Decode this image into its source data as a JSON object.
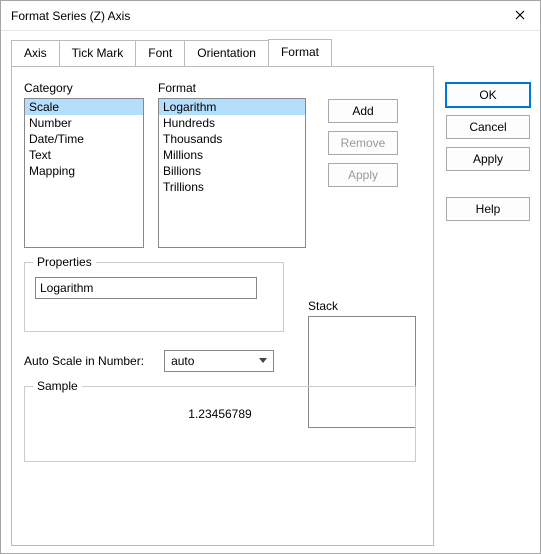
{
  "window": {
    "title": "Format Series (Z) Axis"
  },
  "tabs": [
    "Axis",
    "Tick Mark",
    "Font",
    "Orientation",
    "Format"
  ],
  "active_tab": "Format",
  "labels": {
    "category": "Category",
    "format": "Format",
    "properties": "Properties",
    "stack": "Stack",
    "autoscale": "Auto Scale in Number:",
    "sample": "Sample"
  },
  "category": {
    "items": [
      "Scale",
      "Number",
      "Date/Time",
      "Text",
      "Mapping"
    ],
    "selected": "Scale"
  },
  "format_list": {
    "items": [
      "Logarithm",
      "Hundreds",
      "Thousands",
      "Millions",
      "Billions",
      "Trillions"
    ],
    "selected": "Logarithm"
  },
  "ops": {
    "add": "Add",
    "remove": "Remove",
    "apply": "Apply"
  },
  "properties": {
    "value": "Logarithm"
  },
  "autoscale": {
    "value": "auto"
  },
  "sample": {
    "value": "1.23456789"
  },
  "side": {
    "ok": "OK",
    "cancel": "Cancel",
    "apply": "Apply",
    "help": "Help"
  }
}
